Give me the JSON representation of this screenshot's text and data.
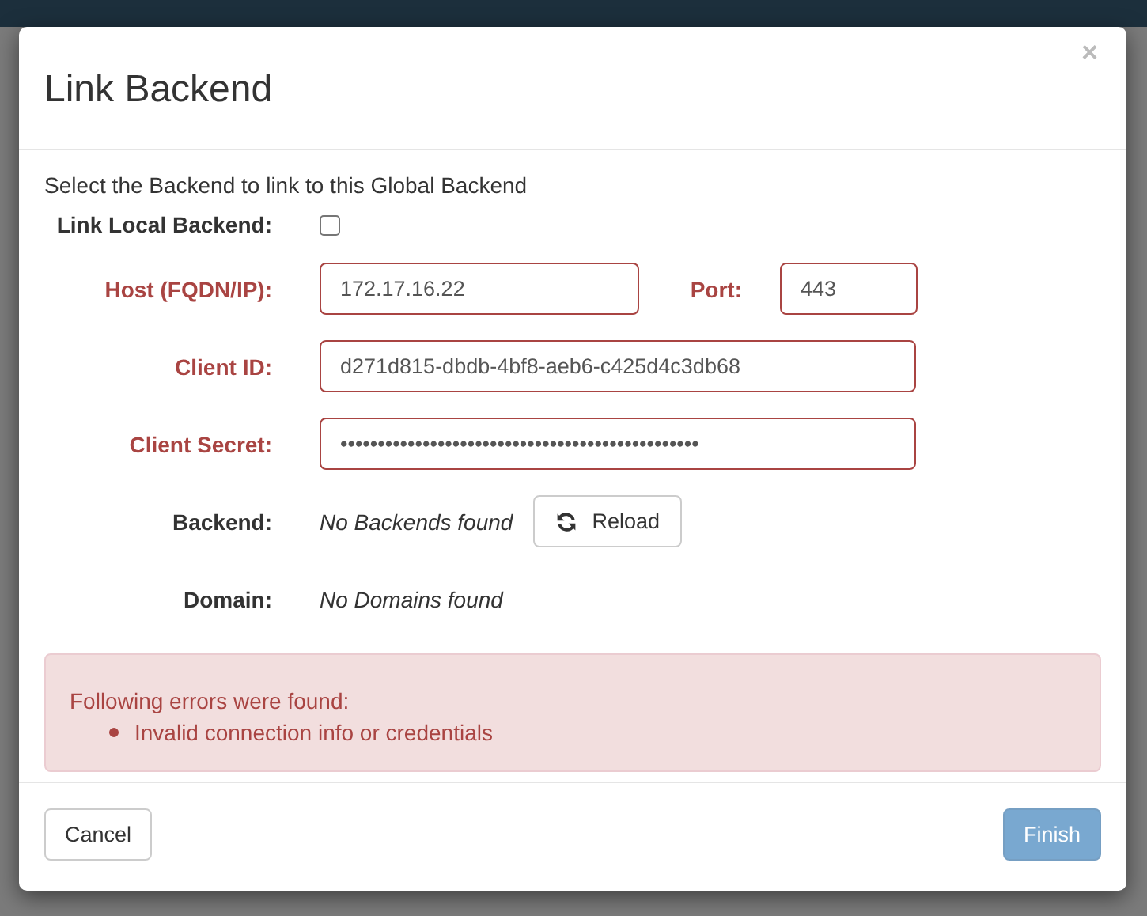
{
  "modal": {
    "title": "Link Backend",
    "close": "×",
    "intro": "Select the Backend to link to this Global Backend",
    "rows": [
      {
        "kind": "checkbox",
        "label": "Link Local Backend:",
        "checked": false,
        "error": false
      },
      {
        "kind": "pair",
        "label": "Host (FQDN/IP):",
        "value": "172.17.16.22",
        "error": true,
        "label2": "Port:",
        "value2": "443"
      },
      {
        "kind": "input",
        "label": "Client ID:",
        "value": "d271d815-dbdb-4bf8-aeb6-c425d4c3db68",
        "error": true
      },
      {
        "kind": "password",
        "label": "Client Secret:",
        "value": "••••••••••••••••••••••••••••••••••••••••••••••••",
        "error": true
      },
      {
        "kind": "note-button",
        "label": "Backend:",
        "note": "No Backends found",
        "button": "Reload",
        "error": false
      },
      {
        "kind": "note",
        "label": "Domain:",
        "note": "No Domains found",
        "error": false
      }
    ],
    "alert": {
      "heading": "Following errors were found:",
      "items": [
        "Invalid connection info or credentials"
      ]
    },
    "buttons": [
      {
        "label": "Cancel",
        "kind": "default",
        "disabled": false
      },
      {
        "label": "Finish",
        "kind": "primary",
        "disabled": true
      }
    ]
  }
}
